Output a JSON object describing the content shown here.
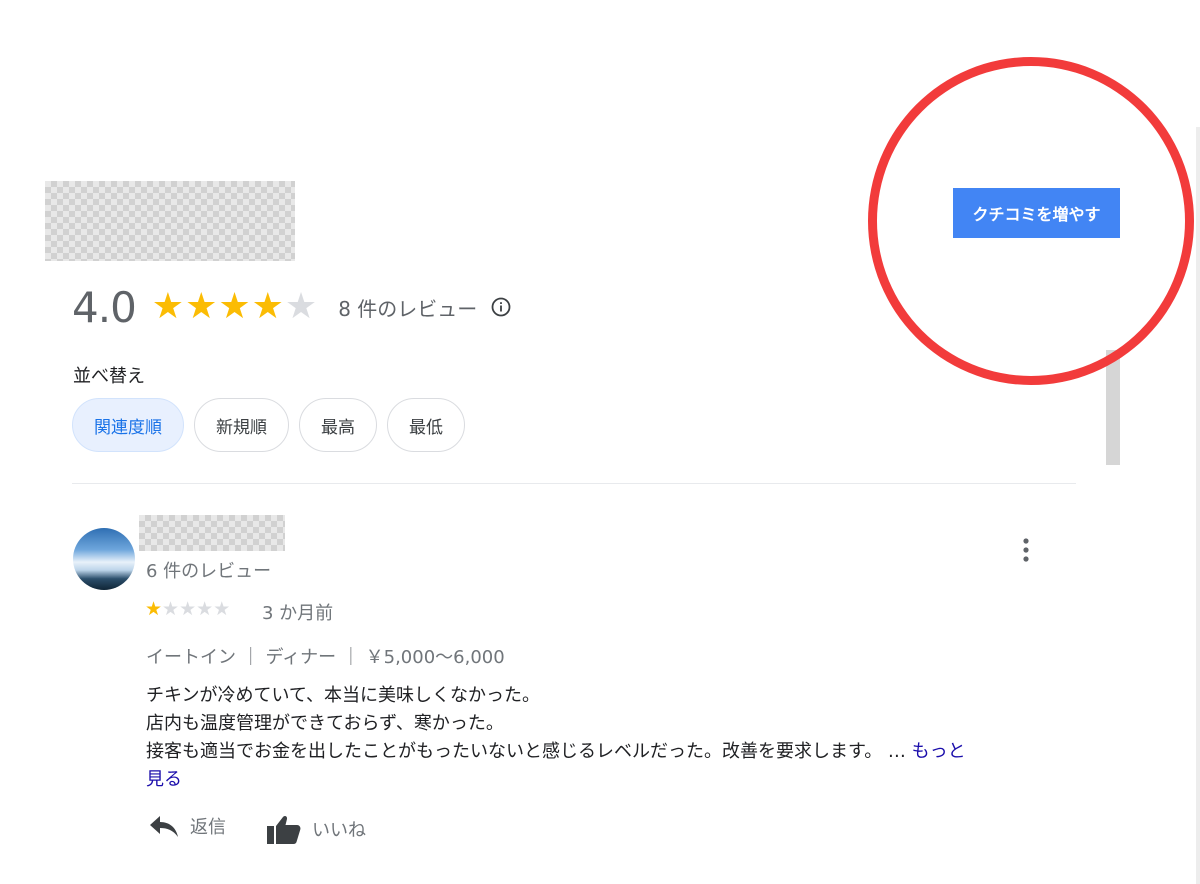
{
  "business": {
    "rating": "4.0",
    "stars": 4,
    "review_count": "8 件のレビュー"
  },
  "cta": {
    "label": "クチコミを増やす"
  },
  "sort": {
    "label": "並べ替え",
    "options": [
      "関連度順",
      "新規順",
      "最高",
      "最低"
    ],
    "selected": "関連度順"
  },
  "review": {
    "reviewer_review_count": "6 件のレビュー",
    "stars": 1,
    "date": "3 か月前",
    "meta": "イートイン ｜ ディナー ｜ ￥5,000～6,000",
    "lines": [
      "チキンが冷めていて、本当に美味しくなかった。",
      "店内も温度管理ができておらず、寒かった。",
      "接客も適当でお金を出したことがもったいないと感じるレベルだった。改善を要求します。 …"
    ],
    "more_part1": "もっと",
    "more_part2": "見る",
    "reply_label": "返信",
    "like_label": "いいね"
  },
  "colors": {
    "accent": "#4285f4",
    "star": "#fbbc04",
    "highlight": "#f23b3b",
    "link": "#1a0dab"
  }
}
